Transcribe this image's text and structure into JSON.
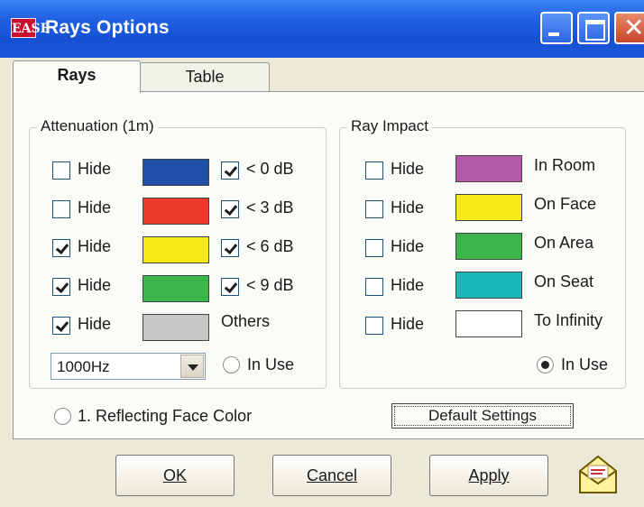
{
  "window": {
    "title": "Rays Options",
    "app_icon_text": "EASE",
    "close_glyph": "✕"
  },
  "tabs": [
    {
      "label": "Rays",
      "active": true
    },
    {
      "label": "Table",
      "active": false
    }
  ],
  "attenuation": {
    "title": "Attenuation (1m)",
    "rows": [
      {
        "hide_label": "Hide",
        "hide_checked": false,
        "color": "#1f4fa6",
        "threshold_label": "< 0 dB",
        "threshold_checked": true
      },
      {
        "hide_label": "Hide",
        "hide_checked": false,
        "color": "#ee3a2c",
        "threshold_label": "< 3 dB",
        "threshold_checked": true
      },
      {
        "hide_label": "Hide",
        "hide_checked": true,
        "color": "#f3ea16",
        "threshold_label": "< 6 dB",
        "threshold_checked": true
      },
      {
        "hide_label": "Hide",
        "hide_checked": true,
        "color": "#3cb54a",
        "threshold_label": "< 9 dB",
        "threshold_checked": true
      },
      {
        "hide_label": "Hide",
        "hide_checked": true,
        "color": "#c6c6c6",
        "threshold_label": "Others"
      }
    ],
    "frequency": "1000Hz",
    "in_use_label": "In Use",
    "in_use_selected": false
  },
  "ray_impact": {
    "title": "Ray Impact",
    "rows": [
      {
        "hide_label": "Hide",
        "hide_checked": false,
        "color": "#b35aa6",
        "label": "In Room"
      },
      {
        "hide_label": "Hide",
        "hide_checked": false,
        "color": "#f3ea16",
        "label": "On Face"
      },
      {
        "hide_label": "Hide",
        "hide_checked": false,
        "color": "#3cb54a",
        "label": "On Area"
      },
      {
        "hide_label": "Hide",
        "hide_checked": false,
        "color": "#16b8b8",
        "label": "On Seat"
      },
      {
        "hide_label": "Hide",
        "hide_checked": false,
        "color": "#ffffff",
        "label": "To Infinity"
      }
    ],
    "in_use_label": "In Use",
    "in_use_selected": true
  },
  "reflecting": {
    "label": "1. Reflecting Face Color",
    "selected": false
  },
  "buttons": {
    "default_settings": "Default Settings",
    "ok": "OK",
    "cancel": "Cancel",
    "apply": "Apply"
  }
}
